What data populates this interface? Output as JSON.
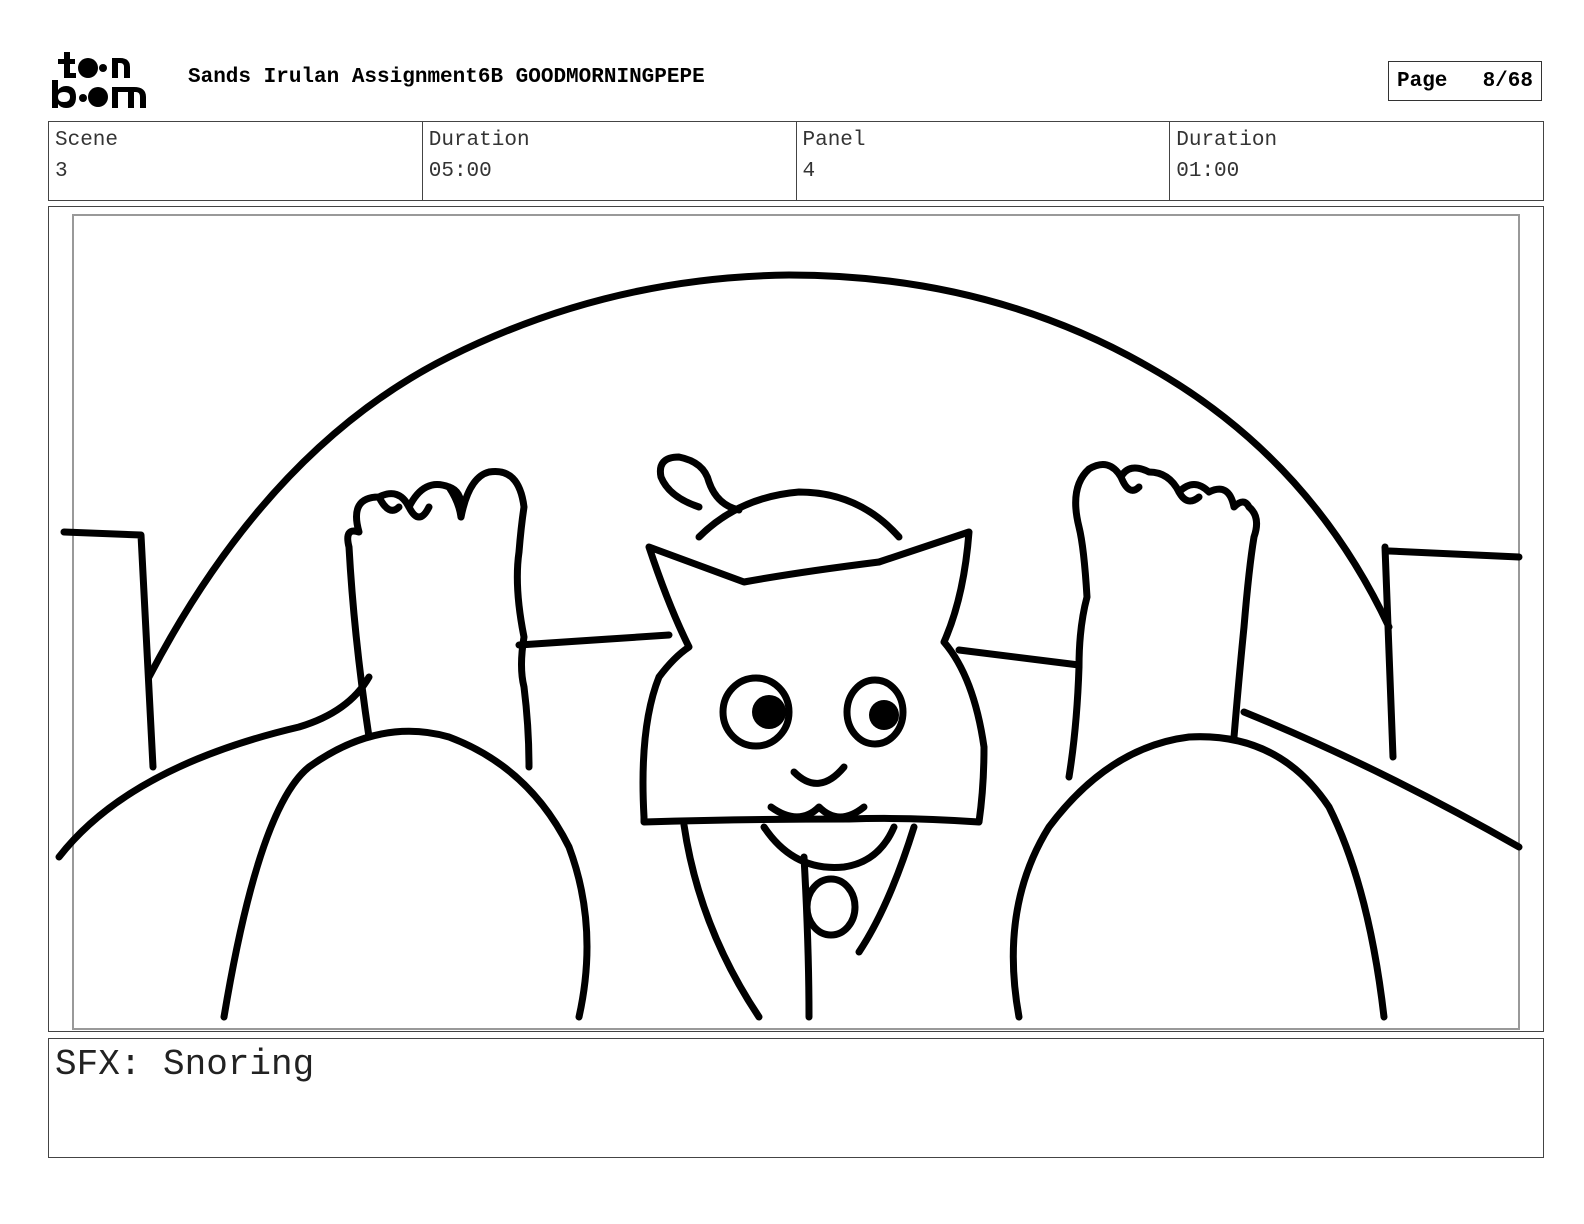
{
  "header": {
    "logo_text": "toon boom",
    "project_title": "Sands Irulan Assignment6B GOODMORNINGPEPE",
    "page_label": "Page",
    "page_number": "8/68"
  },
  "info": {
    "scene_label": "Scene",
    "scene_value": "3",
    "scene_duration_label": "Duration",
    "scene_duration_value": "05:00",
    "panel_label": "Panel",
    "panel_value": "4",
    "panel_duration_label": "Duration",
    "panel_duration_value": "01:00"
  },
  "panel": {
    "drawing": "cat-and-feet-sketch"
  },
  "dialog": {
    "text": "SFX: Snoring"
  }
}
